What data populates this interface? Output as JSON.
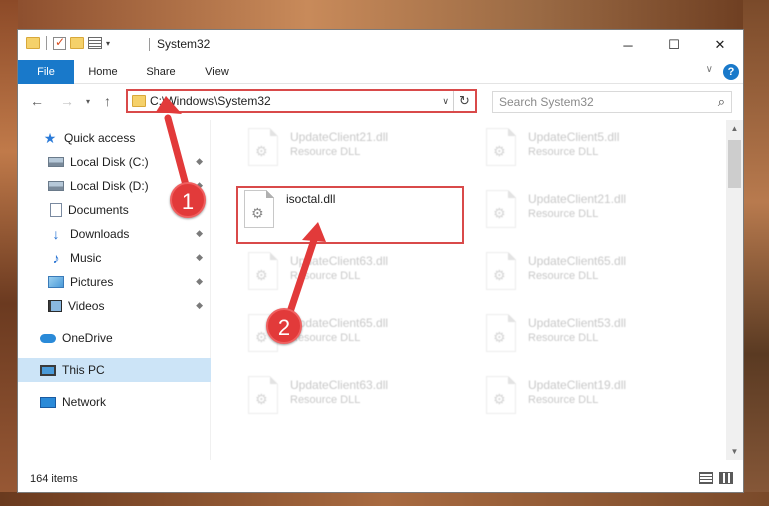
{
  "window": {
    "title": "System32",
    "minimize": "─",
    "maximize": "☐",
    "close": "✕"
  },
  "ribbon": {
    "tabs": [
      {
        "label": "File"
      },
      {
        "label": "Home"
      },
      {
        "label": "Share"
      },
      {
        "label": "View"
      }
    ],
    "expand": "∨",
    "help": "?"
  },
  "nav": {
    "back": "←",
    "forward": "→",
    "recent": "▾",
    "up": "↑",
    "address": "C:\\Windows\\System32",
    "address_drop": "∨",
    "refresh": "↻",
    "search_placeholder": "Search System32",
    "search_icon": "⌕"
  },
  "sidebar": {
    "items": [
      {
        "label": "Quick access",
        "icon": "star-icon"
      },
      {
        "label": "Local Disk (C:)",
        "icon": "disk-icon",
        "pinned": true
      },
      {
        "label": "Local Disk (D:)",
        "icon": "disk-icon",
        "pinned": true
      },
      {
        "label": "Documents",
        "icon": "documents-icon",
        "pinned": true
      },
      {
        "label": "Downloads",
        "icon": "download-icon",
        "pinned": true
      },
      {
        "label": "Music",
        "icon": "music-icon",
        "pinned": true
      },
      {
        "label": "Pictures",
        "icon": "pictures-icon",
        "pinned": true
      },
      {
        "label": "Videos",
        "icon": "videos-icon",
        "pinned": true
      },
      {
        "label": "OneDrive",
        "icon": "cloud-icon"
      },
      {
        "label": "This PC",
        "icon": "computer-icon",
        "selected": true
      },
      {
        "label": "Network",
        "icon": "network-icon"
      }
    ],
    "pin_glyph": "📌"
  },
  "files": [
    {
      "name": "UpdateClient21.dll",
      "type": "Resource DLL"
    },
    {
      "name": "UpdateClient5.dll",
      "type": "Resource DLL"
    },
    {
      "name": "isoctal.dll",
      "type": ""
    },
    {
      "name": "UpdateClient21.dll",
      "type": "Resource DLL"
    },
    {
      "name": "UpdateClient63.dll",
      "type": "Resource DLL"
    },
    {
      "name": "UpdateClient65.dll",
      "type": "Resource DLL"
    },
    {
      "name": "UpdateClient65.dll",
      "type": "Resource DLL"
    },
    {
      "name": "UpdateClient53.dll",
      "type": "Resource DLL"
    },
    {
      "name": "UpdateClient63.dll",
      "type": "Resource DLL"
    },
    {
      "name": "UpdateClient19.dll",
      "type": "Resource DLL"
    }
  ],
  "status": {
    "item_count": "164 items"
  },
  "annotations": {
    "step1": "1",
    "step2": "2",
    "color": "#e23a3a"
  }
}
